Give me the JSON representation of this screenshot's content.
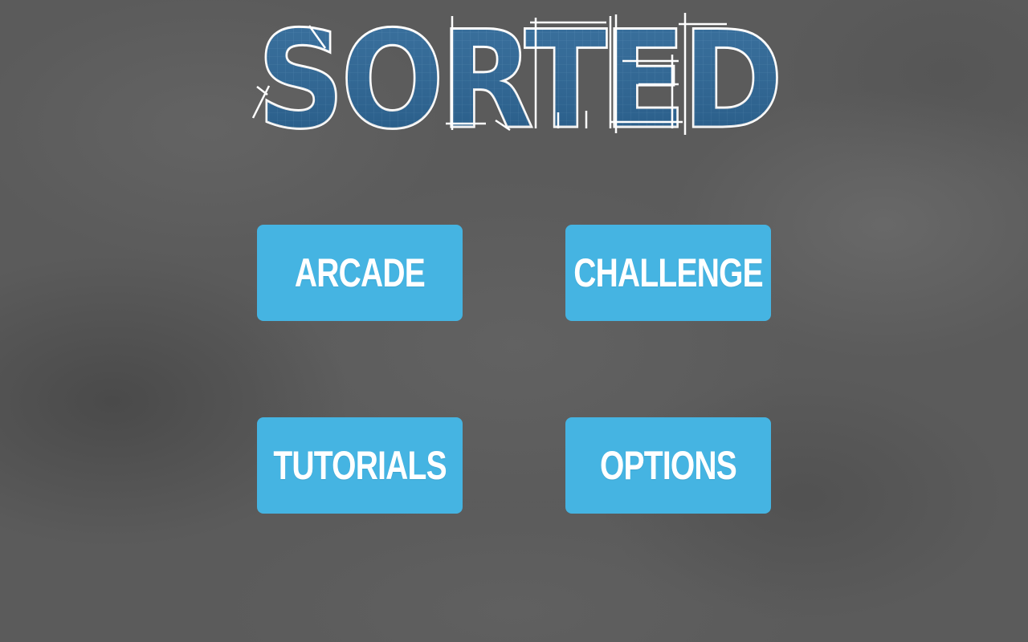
{
  "game": {
    "title": "SORTED"
  },
  "menu": {
    "buttons": [
      {
        "id": "arcade",
        "label": "ARCADE"
      },
      {
        "id": "challenge",
        "label": "CHALLENGE"
      },
      {
        "id": "tutorials",
        "label": "TUTORIALS"
      },
      {
        "id": "options",
        "label": "OPTIONS"
      }
    ]
  },
  "colors": {
    "background": "#5b5b5b",
    "button": "#45b4e2",
    "button_text": "#ffffff",
    "logo_fill": "#2a6596",
    "logo_outline": "#ffffff"
  }
}
